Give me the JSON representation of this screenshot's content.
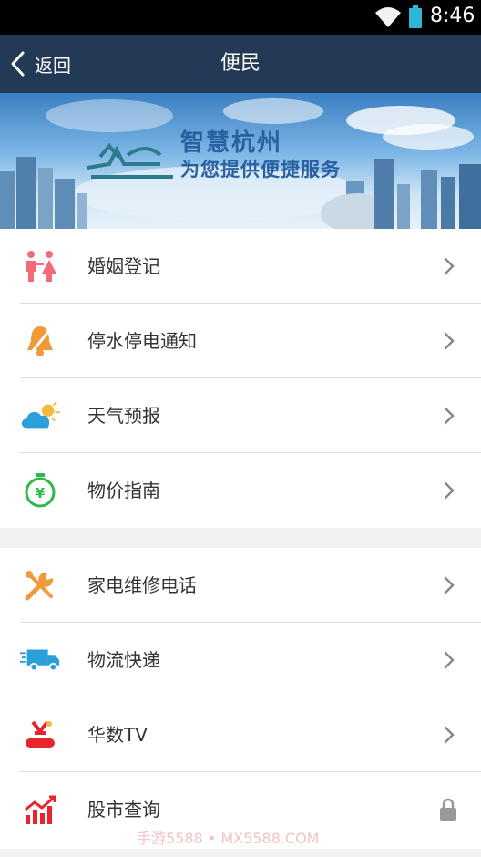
{
  "status_bar": {
    "time": "8:46"
  },
  "nav": {
    "back_label": "返回",
    "title": "便民"
  },
  "banner": {
    "title": "智慧杭州",
    "subtitle": "为您提供便捷服务"
  },
  "group1": [
    {
      "label": "婚姻登记",
      "icon": "couple-icon",
      "trailing": "chevron"
    },
    {
      "label": "停水停电通知",
      "icon": "bell-mute-icon",
      "trailing": "chevron"
    },
    {
      "label": "天气预报",
      "icon": "weather-icon",
      "trailing": "chevron"
    },
    {
      "label": "物价指南",
      "icon": "price-clock-icon",
      "trailing": "chevron"
    }
  ],
  "group2": [
    {
      "label": "家电维修电话",
      "icon": "tools-icon",
      "trailing": "chevron"
    },
    {
      "label": "物流快递",
      "icon": "truck-icon",
      "trailing": "chevron"
    },
    {
      "label": "华数TV",
      "icon": "wasu-tv-icon",
      "trailing": "chevron"
    },
    {
      "label": "股市查询",
      "icon": "stock-chart-icon",
      "trailing": "lock"
    }
  ],
  "watermark": "手游5588 • MX5588.COM",
  "colors": {
    "nav_bg": "#223a55",
    "banner_text": "#2a5fa0"
  }
}
